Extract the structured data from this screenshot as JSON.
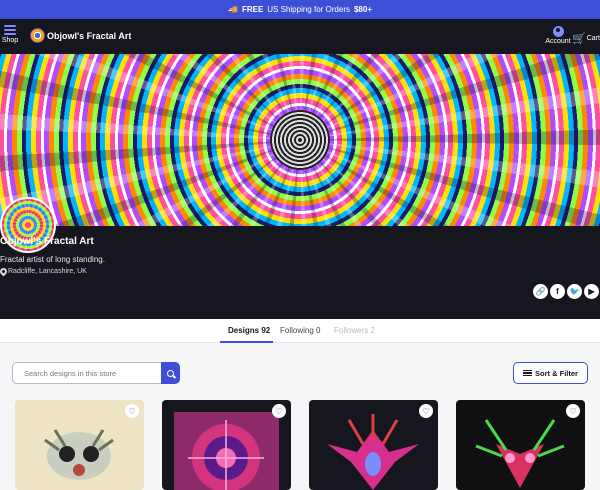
{
  "promo": {
    "bold": "FREE",
    "text": "US Shipping for Orders",
    "amount": "$80+"
  },
  "header": {
    "shop_label": "Shop",
    "store_title": "Objowl's Fractal Art",
    "account_label": "Account",
    "cart_label": "Cart"
  },
  "profile": {
    "name": "Objowl's Fractal Art",
    "tagline": "Fractal artist of long standing.",
    "location": "Radcliffe, Lancashire, UK",
    "socials": [
      {
        "icon": "link-icon",
        "glyph": "🔗"
      },
      {
        "icon": "facebook-icon",
        "glyph": "f"
      },
      {
        "icon": "twitter-icon",
        "glyph": "🐦"
      },
      {
        "icon": "youtube-icon",
        "glyph": "▶"
      }
    ]
  },
  "tabs": [
    {
      "label": "Designs 92",
      "state": "active"
    },
    {
      "label": "Following 0",
      "state": "normal"
    },
    {
      "label": "Followers 2",
      "state": "disabled"
    }
  ],
  "search": {
    "placeholder": "Search designs in this store"
  },
  "sort_filter_label": "Sort & Filter",
  "colors": {
    "accent": "#3d4fd6",
    "header_bg": "#16161f",
    "page_bg": "#f6f6f8"
  }
}
